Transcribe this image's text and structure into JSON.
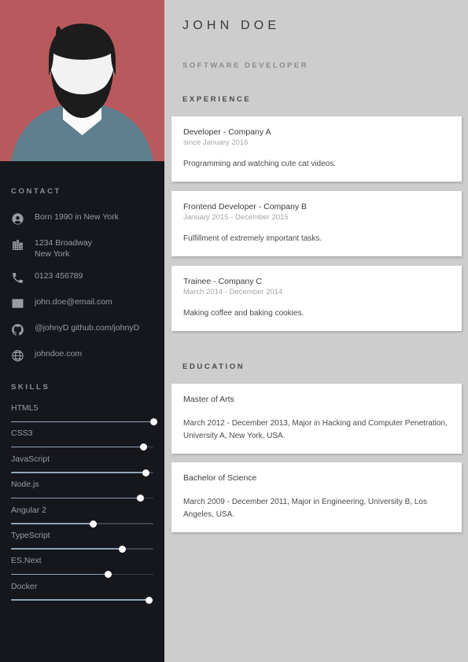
{
  "colors": {
    "sidebar_bg": "#16161d",
    "photo_bg": "#b85a5d",
    "page_bg": "#cdcdcd",
    "card_bg": "#ffffff",
    "slider_fill": "#8ea5b8",
    "slider_track": "#3a4450",
    "slider_thumb": "#ffffff",
    "shirt": "#5f7f8e",
    "hair": "#1c1c1c",
    "skin": "#f1f1f1"
  },
  "header": {
    "name": "JOHN DOE",
    "job_title": "SOFTWARE DEVELOPER"
  },
  "sidebar": {
    "avatar_alt": "avatar-illustration",
    "contact": {
      "title": "CONTACT",
      "items": [
        {
          "icon": "person-icon",
          "text": "Born 1990 in New York"
        },
        {
          "icon": "building-icon",
          "text": "1234 Broadway\nNew York"
        },
        {
          "icon": "phone-icon",
          "text": "0123 456789"
        },
        {
          "icon": "envelope-icon",
          "text": "john.doe@email.com"
        },
        {
          "icon": "github-icon",
          "text": "@johnyD github.com/johnyD"
        },
        {
          "icon": "globe-icon",
          "text": "johndoe.com"
        }
      ]
    },
    "skills": {
      "title": "SKILLS",
      "items": [
        {
          "label": "HTML5",
          "value": 100
        },
        {
          "label": "CSS3",
          "value": 93
        },
        {
          "label": "JavaScript",
          "value": 95
        },
        {
          "label": "Node.js",
          "value": 91
        },
        {
          "label": "Angular 2",
          "value": 58
        },
        {
          "label": "TypeScript",
          "value": 78
        },
        {
          "label": "ES.Next",
          "value": 68
        },
        {
          "label": "Docker",
          "value": 97
        }
      ]
    }
  },
  "main": {
    "experience": {
      "title": "EXPERIENCE",
      "items": [
        {
          "heading": "Developer - Company A",
          "sub": "since January 2016",
          "body": "Programming and watching cute cat videos."
        },
        {
          "heading": "Frontend Developer - Company B",
          "sub": "January 2015 - December 2015",
          "body": "Fulfillment of extremely important tasks."
        },
        {
          "heading": "Trainee - Company C",
          "sub": "March 2014 - December 2014",
          "body": "Making coffee and baking cookies."
        }
      ]
    },
    "education": {
      "title": "EDUCATION",
      "items": [
        {
          "heading": "Master of Arts",
          "body": "March 2012 - December 2013, Major in Hacking and Computer Penetration, University A, New York, USA."
        },
        {
          "heading": "Bachelor of Science",
          "body": "March 2009 - December 2011, Major in Engineering, University B, Los Angeles, USA."
        }
      ]
    }
  }
}
